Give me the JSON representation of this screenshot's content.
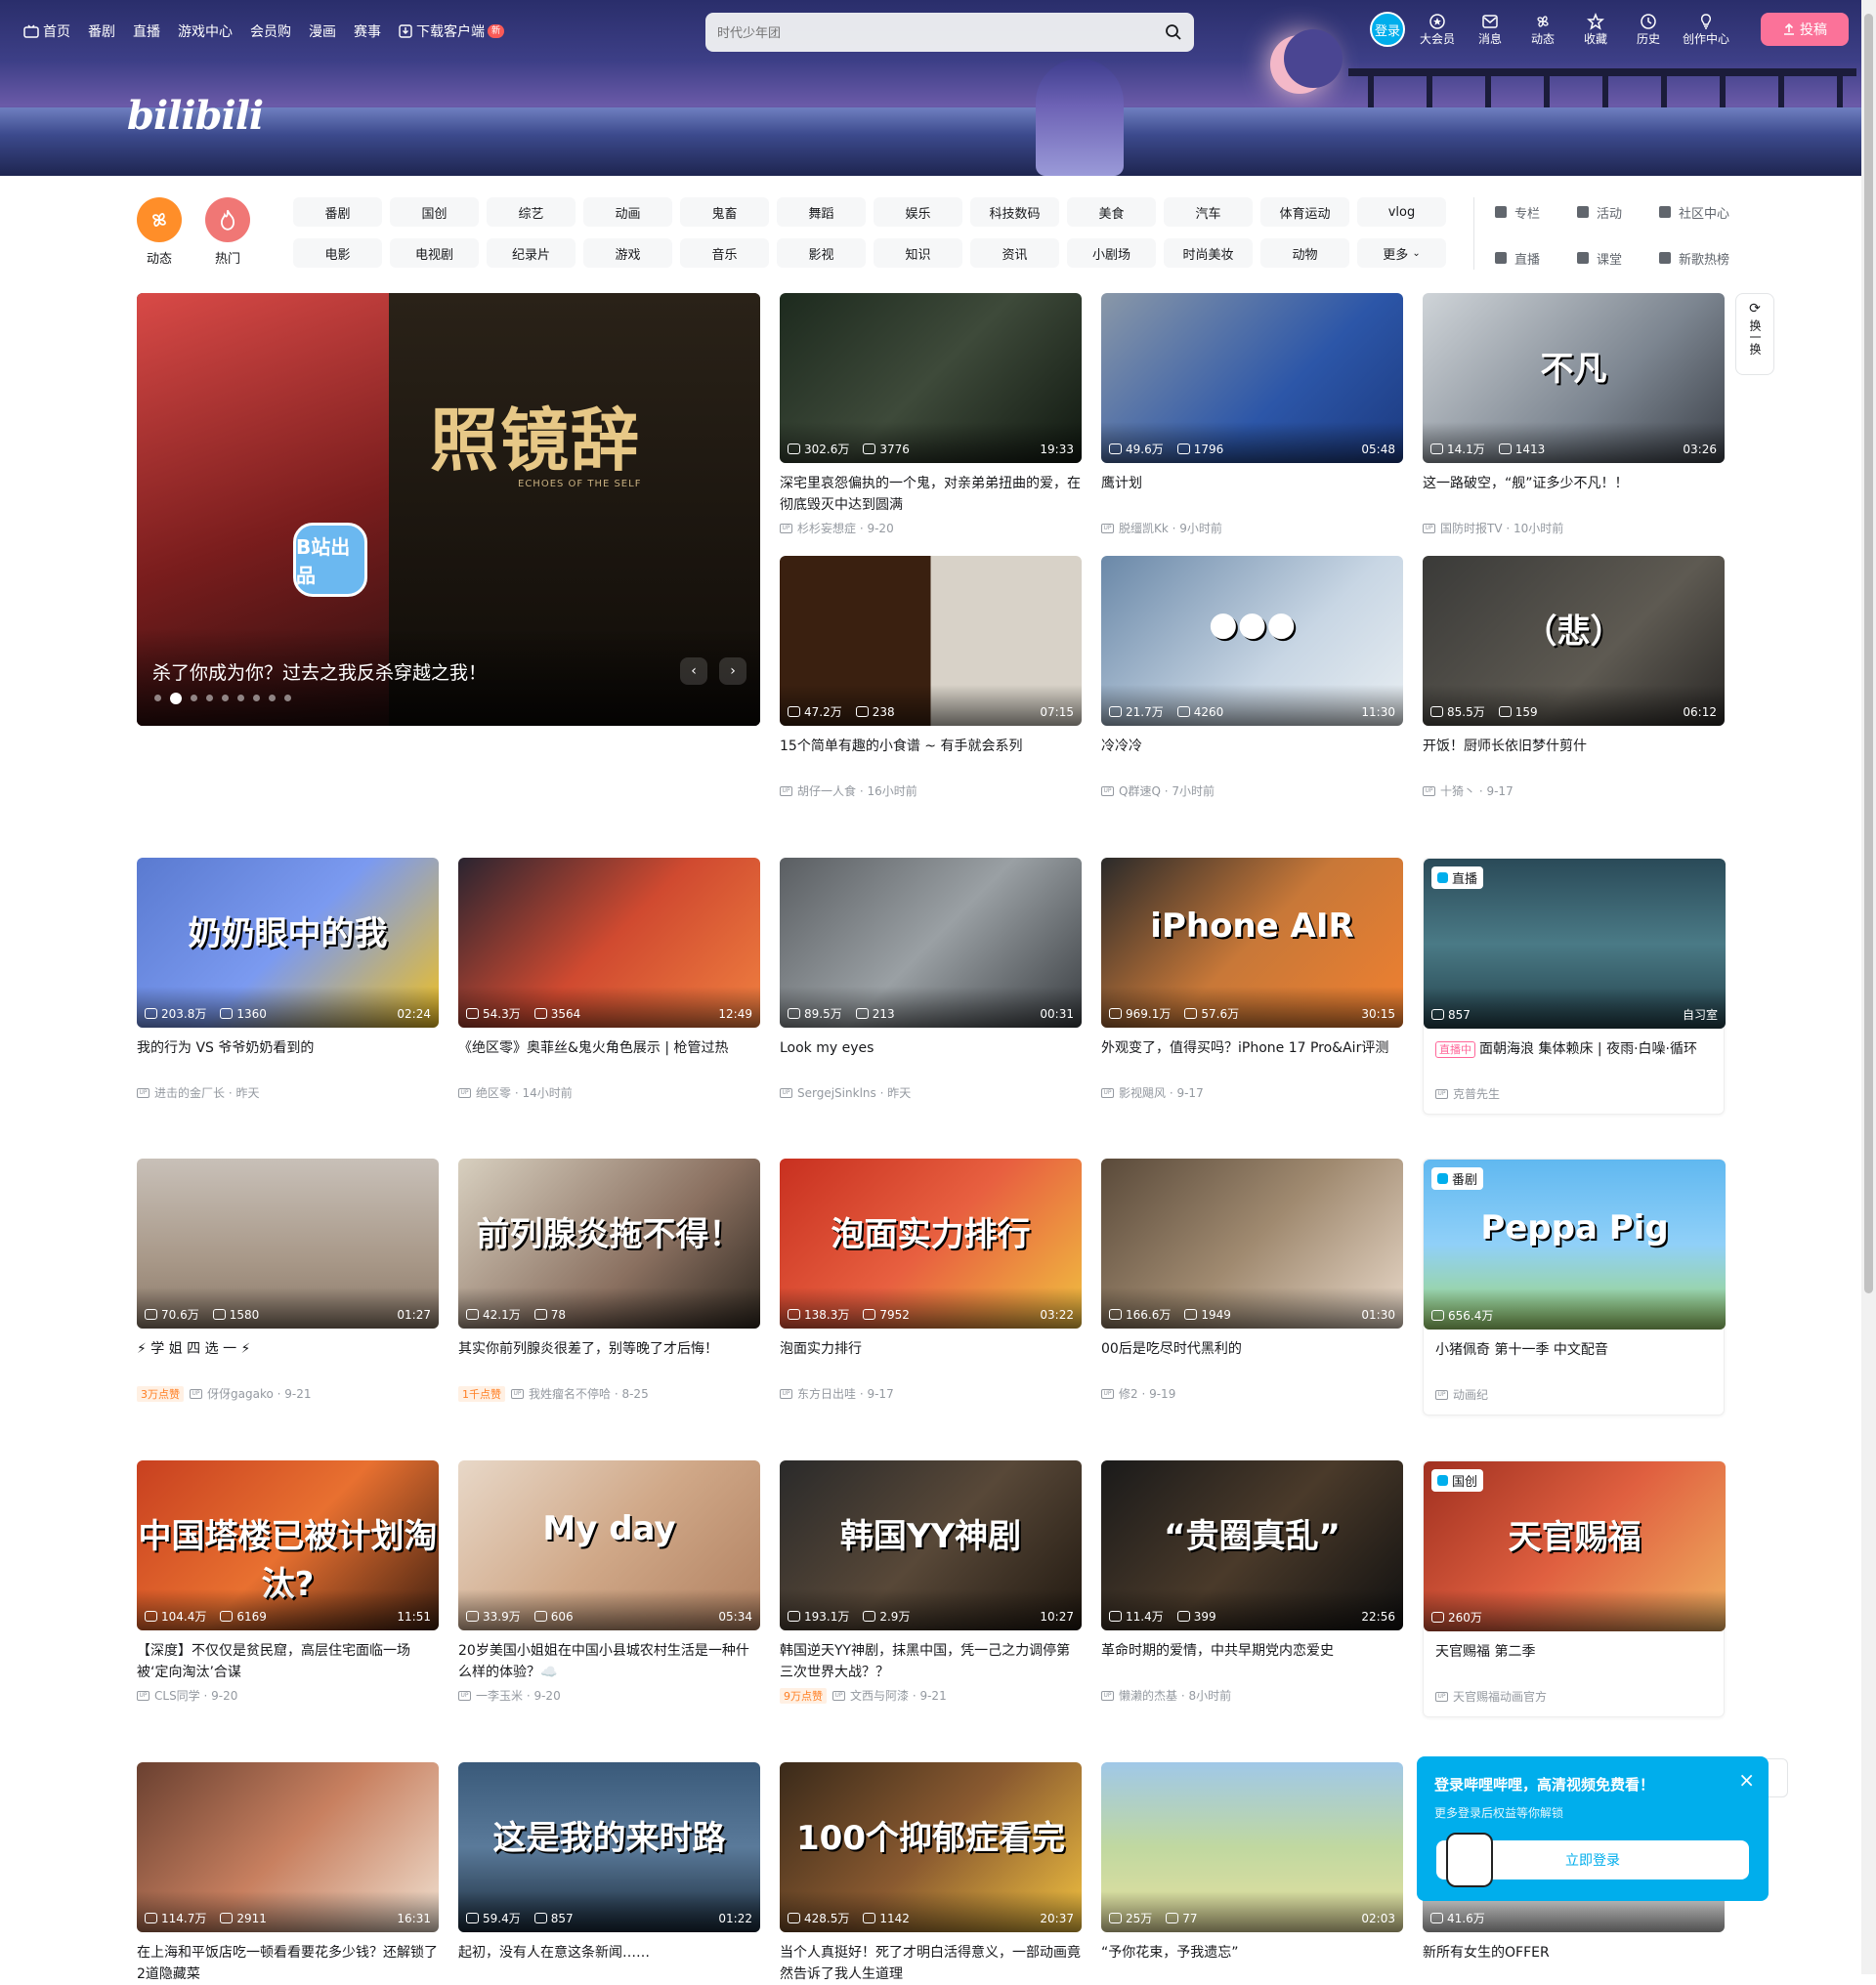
{
  "nav": {
    "links": [
      {
        "label": "首页",
        "icon": "tv-icon"
      },
      {
        "label": "番剧"
      },
      {
        "label": "直播"
      },
      {
        "label": "游戏中心"
      },
      {
        "label": "会员购"
      },
      {
        "label": "漫画"
      },
      {
        "label": "赛事"
      },
      {
        "label": "下载客户端",
        "icon": "download-icon",
        "badge": "新"
      }
    ],
    "search_placeholder": "时代少年团",
    "login": "登录",
    "tools": [
      "大会员",
      "消息",
      "动态",
      "收藏",
      "历史",
      "创作中心"
    ],
    "upload": "投稿"
  },
  "channels": {
    "round": [
      {
        "label": "动态",
        "color": "#ff8e29"
      },
      {
        "label": "热门",
        "color": "#f07775"
      }
    ],
    "grid": [
      "番剧",
      "国创",
      "综艺",
      "动画",
      "鬼畜",
      "舞蹈",
      "娱乐",
      "科技数码",
      "美食",
      "汽车",
      "体育运动",
      "vlog",
      "电影",
      "电视剧",
      "纪录片",
      "游戏",
      "音乐",
      "影视",
      "知识",
      "资讯",
      "小剧场",
      "时尚美妆",
      "动物",
      "更多"
    ],
    "side": [
      "专栏",
      "活动",
      "社区中心",
      "直播",
      "课堂",
      "新歌热榜"
    ]
  },
  "carousel": {
    "caption": "杀了你成为你？过去之我反杀穿越之我！",
    "art_title": "照镜辞",
    "art_sub": "ECHOES OF THE SELF",
    "stamp": "B站出品",
    "dots": 9,
    "active_dot": 1
  },
  "refresh": "换一换",
  "cards": [
    {
      "views": "302.6万",
      "danmaku": "3776",
      "duration": "19:33",
      "title": "深宅里哀怨偏执的一个鬼，对亲弟弟扭曲的爱，在彻底毁灭中达到圆满",
      "author": "杉杉妄想症",
      "date": "9-20",
      "bg": "linear-gradient(135deg,#1d2a1e,#3e4a3a 50%,#101810)"
    },
    {
      "views": "49.6万",
      "danmaku": "1796",
      "duration": "05:48",
      "title": "鹰计划",
      "author": "脱缰凯Kk",
      "date": "9小时前",
      "bg": "linear-gradient(135deg,#8a98a8,#2c56a8 60%,#1c3a80)"
    },
    {
      "views": "14.1万",
      "danmaku": "1413",
      "duration": "03:26",
      "title": "这一路破空，“舰”证多少不凡！！",
      "author": "国防时报TV",
      "date": "10小时前",
      "bg": "linear-gradient(135deg,#cfd4d8,#7c8590 60%,#3b4048)",
      "art": "不凡"
    },
    {
      "views": "47.2万",
      "danmaku": "238",
      "duration": "07:15",
      "title": "15个简单有趣的小食谱 ~ 有手就会系列",
      "author": "胡仔一人食",
      "date": "16小时前",
      "bg": "linear-gradient(90deg,#3a2010 50%,#d8d2c8 50%)"
    },
    {
      "views": "21.7万",
      "danmaku": "4260",
      "duration": "11:30",
      "title": "冷冷冷",
      "author": "Q群速Q",
      "date": "7小时前",
      "bg": "linear-gradient(135deg,#6a88a8,#c8d6e4 60%,#e8eef2)",
      "art": "●●●"
    },
    {
      "views": "85.5万",
      "danmaku": "159",
      "duration": "06:12",
      "title": "开饭！厨师长依旧梦什剪什",
      "author": "十猗丶",
      "date": "9-17",
      "bg": "linear-gradient(135deg,#3a3a38,#5e5a52 60%,#2a2826)",
      "art": "（悲）"
    },
    {
      "views": "203.8万",
      "danmaku": "1360",
      "duration": "02:24",
      "title": "我的行为 VS 爷爷奶奶看到的",
      "author": "进击的金厂长",
      "date": "昨天",
      "bg": "linear-gradient(135deg,#5a7ad0,#7b9af0 50%,#f0c020)",
      "art": "奶奶眼中的我"
    },
    {
      "views": "54.3万",
      "danmaku": "3564",
      "duration": "12:49",
      "title": "《绝区零》奥菲丝&鬼火角色展示 | 枪管过热",
      "author": "绝区零",
      "date": "14小时前",
      "bg": "linear-gradient(135deg,#2a2430,#d04a30 50%,#f08040)"
    },
    {
      "views": "89.5万",
      "danmaku": "213",
      "duration": "00:31",
      "title": "Look my eyes",
      "author": "SergejSinklns",
      "date": "昨天",
      "bg": "linear-gradient(135deg,#5a5e62,#9aa0a4 50%,#3a3e42)"
    },
    {
      "views": "969.1万",
      "danmaku": "57.6万",
      "duration": "30:15",
      "title": "外观变了，值得买吗？iPhone 17 Pro&Air评测",
      "author": "影视飓风",
      "date": "9-17",
      "bg": "linear-gradient(135deg,#2a2a2a,#c87838 50%,#f08030)",
      "art": "iPhone AIR"
    },
    {
      "views": "857",
      "duration": "自习室",
      "title": "面朝海浪 集体赖床 | 夜雨·白噪·循环",
      "author": "克普先生",
      "badge": "直播",
      "live_tag": "直播中",
      "bg": "linear-gradient(180deg,#2a4a58,#4a7a86 50%,#23404a)"
    },
    {
      "views": "70.6万",
      "danmaku": "1580",
      "duration": "01:27",
      "title": "⚡ 学 姐 四 选 一 ⚡",
      "author": "伢伢gagako",
      "date": "9-21",
      "hot": "3万点赞",
      "bg": "linear-gradient(180deg,#c8c0b8,#a89888 60%,#8c7a6a)"
    },
    {
      "views": "42.1万",
      "danmaku": "78",
      "duration": "",
      "title": "其实你前列腺炎很差了，别等晚了才后悔！",
      "author": "我姓瘤名不停哈",
      "date": "8-25",
      "hot": "1千点赞",
      "bg": "linear-gradient(135deg,#d8d0c0,#8a7060 60%,#302820)",
      "art": "前列腺炎拖不得！"
    },
    {
      "views": "138.3万",
      "danmaku": "7952",
      "duration": "03:22",
      "title": "泡面实力排行",
      "author": "东方日出哇",
      "date": "9-17",
      "bg": "linear-gradient(135deg,#c83020,#e86040 50%,#f0c040)",
      "art": "泡面实力排行"
    },
    {
      "views": "166.6万",
      "danmaku": "1949",
      "duration": "01:30",
      "title": "00后是吃尽时代黑利的",
      "author": "修2",
      "date": "9-19",
      "bg": "linear-gradient(135deg,#5a4a3a,#a08a70 50%,#e8d8c8)"
    },
    {
      "views": "656.4万",
      "duration": "",
      "title": "小猪佩奇 第十一季 中文配音",
      "author": "动画纪",
      "badge": "番剧",
      "bg": "linear-gradient(180deg,#60b8f0,#90d0f8 50%,#a0d870)",
      "art": "Peppa Pig"
    },
    {
      "views": "104.4万",
      "danmaku": "6169",
      "duration": "11:51",
      "title": "【深度】不仅仅是贫民窟，高层住宅面临一场被‘定向淘汰’合谋",
      "author": "CLS同学",
      "date": "9-20",
      "bg": "linear-gradient(135deg,#c84020,#e87030 50%,#402010)",
      "art": "中国塔楼已被计划淘汰?"
    },
    {
      "views": "33.9万",
      "danmaku": "606",
      "duration": "05:34",
      "title": "20岁美国小姐姐在中国小县城农村生活是一种什么样的体验？☁️",
      "author": "一李玉米",
      "date": "9-20",
      "bg": "linear-gradient(135deg,#e8d8c8,#d0a888 50%,#b08060)",
      "art": "My day"
    },
    {
      "views": "193.1万",
      "danmaku": "2.9万",
      "duration": "10:27",
      "title": "韩国逆天YY神剧，抹黑中国，凭一己之力调停第三次世界大战？？",
      "author": "文西与阿漆",
      "date": "9-21",
      "hot": "9万点赞",
      "bg": "linear-gradient(135deg,#2a2a2a,#584838 50%,#201810)",
      "art": "韩国YY神剧"
    },
    {
      "views": "11.4万",
      "danmaku": "399",
      "duration": "22:56",
      "title": "革命时期的爱情，中共早期党内恋爱史",
      "author": "懒濑的杰基",
      "date": "8小时前",
      "bg": "linear-gradient(135deg,#1a1a1a,#4a3a2a 50%,#101010)",
      "art": "“贵圈真乱”"
    },
    {
      "views": "260万",
      "duration": "",
      "title": "天官赐福 第二季",
      "author": "天官赐福动画官方",
      "badge": "国创",
      "bg": "linear-gradient(135deg,#a03020,#e06040 50%,#f0b060)",
      "art": "天官赐福"
    },
    {
      "views": "114.7万",
      "danmaku": "2911",
      "duration": "16:31",
      "title": "在上海和平饭店吃一顿看看要花多少钱？还解锁了2道隐藏菜",
      "bg": "linear-gradient(135deg,#6a4030,#c88060 50%,#f0e0d0)"
    },
    {
      "views": "59.4万",
      "danmaku": "857",
      "duration": "01:22",
      "title": "起初，没有人在意这条新闻……",
      "bg": "linear-gradient(180deg,#3a5a7a,#5a7a9a 50%,#1a2a3a)",
      "art": "这是我的来时路"
    },
    {
      "views": "428.5万",
      "danmaku": "1142",
      "duration": "20:37",
      "title": "当个人真挺好！死了才明白活得意义，一部动画竟然告诉了我人生道理",
      "bg": "linear-gradient(135deg,#3a2a1a,#8a5a30 50%,#f0c040)",
      "art": "100个抑郁症看完"
    },
    {
      "views": "25万",
      "danmaku": "77",
      "duration": "02:03",
      "title": "“予你花束，予我遗忘”",
      "bg": "linear-gradient(180deg,#a0c8e8,#c0d8a0 50%,#e8e0a0)"
    },
    {
      "views": "41.6万",
      "duration": "",
      "title": "新所有女生的OFFER",
      "bg": "linear-gradient(180deg,#e8e8e8,#c8c8c8)"
    }
  ],
  "popup": {
    "heading": "登录哔哩哔哩，高清视频免费看！",
    "sub": "更多登录后权益等你解锁",
    "button": "立即登录"
  }
}
